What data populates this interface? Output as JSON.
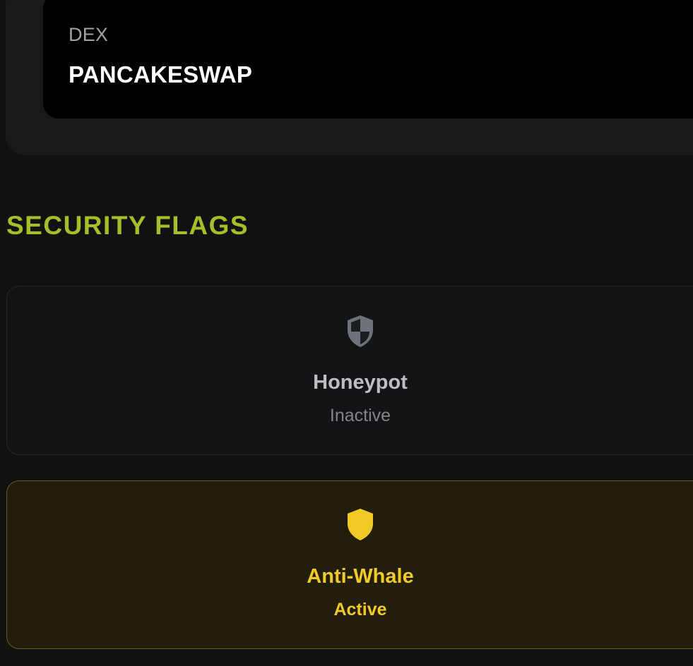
{
  "dex": {
    "label": "DEX",
    "value": "PANCAKESWAP"
  },
  "security": {
    "title": "SECURITY FLAGS",
    "flags": [
      {
        "name": "Honeypot",
        "status": "Inactive",
        "icon": "shield-half-icon",
        "color": "#bdbec2"
      },
      {
        "name": "Anti-Whale",
        "status": "Active",
        "icon": "shield-icon",
        "color": "#f2ca27"
      }
    ]
  },
  "colors": {
    "accent": "#a7bd2a",
    "active": "#f2ca27",
    "background": "#111111"
  }
}
